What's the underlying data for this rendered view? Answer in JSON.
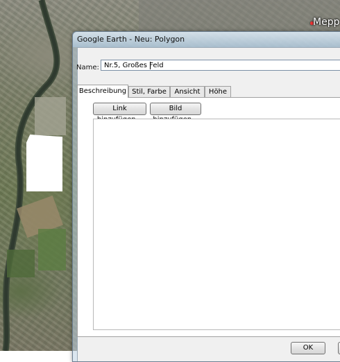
{
  "map": {
    "city_label": "Mepp"
  },
  "dialog": {
    "title": "Google Earth - Neu: Polygon",
    "name_label": "Name:",
    "name_value": "Nr.5, Großes Feld",
    "tabs": [
      {
        "label": "Beschreibung",
        "active": true
      },
      {
        "label": "Stil, Farbe",
        "active": false
      },
      {
        "label": "Ansicht",
        "active": false
      },
      {
        "label": "Höhe",
        "active": false
      }
    ],
    "add_link_label": "Link hinzufügen...",
    "add_image_label": "Bild hinzufügen...",
    "ok_label": "OK"
  }
}
